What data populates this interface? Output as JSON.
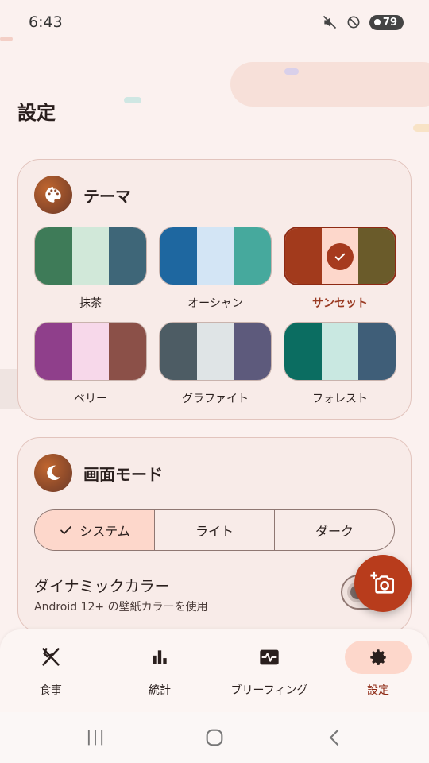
{
  "status_bar": {
    "time": "6:43",
    "battery": "79"
  },
  "page": {
    "title": "設定"
  },
  "theme_card": {
    "title": "テーマ",
    "themes": [
      {
        "label": "抹茶",
        "colors": [
          "#3e7b58",
          "#d1e8d9",
          "#3e6678"
        ],
        "selected": false
      },
      {
        "label": "オーシャン",
        "colors": [
          "#1e67a0",
          "#d3e5f5",
          "#46a99d"
        ],
        "selected": false
      },
      {
        "label": "サンセット",
        "colors": [
          "#a23a1c",
          "#fdd7cb",
          "#6a5b2a"
        ],
        "selected": true
      },
      {
        "label": "ベリー",
        "colors": [
          "#8f3f8b",
          "#f7d8ea",
          "#8b5048"
        ],
        "selected": false
      },
      {
        "label": "グラファイト",
        "colors": [
          "#4d5c64",
          "#dfe4e6",
          "#5d5a7c"
        ],
        "selected": false
      },
      {
        "label": "フォレスト",
        "colors": [
          "#0b6d61",
          "#c9e8e1",
          "#3f5e78"
        ],
        "selected": false
      }
    ]
  },
  "mode_card": {
    "title": "画面モード",
    "segments": [
      "システム",
      "ライト",
      "ダーク"
    ],
    "selected_segment": 0,
    "dynamic_color_title": "ダイナミックカラー",
    "dynamic_color_subtitle": "Android 12+ の壁紙カラーを使用",
    "dynamic_color_enabled": false
  },
  "bottom_nav": {
    "items": [
      {
        "label": "食事",
        "icon": "utensils-icon",
        "active": false
      },
      {
        "label": "統計",
        "icon": "bar-chart-icon",
        "active": false
      },
      {
        "label": "ブリーフィング",
        "icon": "pulse-monitor-icon",
        "active": false
      },
      {
        "label": "設定",
        "icon": "gear-icon",
        "active": true
      }
    ]
  },
  "colors": {
    "accent": "#a63a1e",
    "accent_container": "#fdd7cb",
    "background": "#fbf1ef"
  }
}
